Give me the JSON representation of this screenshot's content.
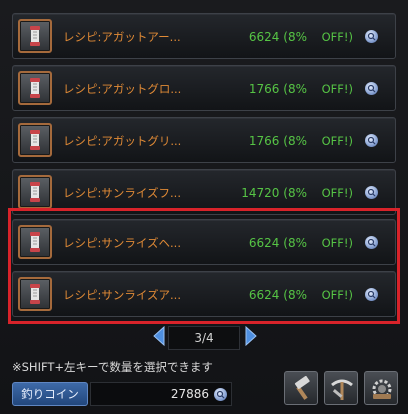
{
  "items": [
    {
      "name": "レシピ:アガットアー...",
      "price": "6624",
      "rate": "(8%",
      "status": "OFF!)"
    },
    {
      "name": "レシピ:アガットグロ...",
      "price": "1766",
      "rate": "(8%",
      "status": "OFF!)"
    },
    {
      "name": "レシピ:アガットグリ...",
      "price": "1766",
      "rate": "(8%",
      "status": "OFF!)"
    },
    {
      "name": "レシピ:サンライズフ...",
      "price": "14720",
      "rate": "(8%",
      "status": "OFF!)"
    },
    {
      "name": "レシピ:サンライズヘ...",
      "price": "6624",
      "rate": "(8%",
      "status": "OFF!)"
    },
    {
      "name": "レシピ:サンライズア...",
      "price": "6624",
      "rate": "(8%",
      "status": "OFF!)"
    }
  ],
  "pager": {
    "current": "3/4"
  },
  "hint": "※SHIFT+左キーで数量を選択できます",
  "currency": {
    "label": "釣りコイン",
    "value": "27886"
  },
  "tools": [
    "hammer-icon",
    "pickaxe-tools-icon",
    "gear-box-icon"
  ],
  "colors": {
    "name": "#e08a36",
    "price": "#56c445",
    "highlight": "#d8232a"
  }
}
